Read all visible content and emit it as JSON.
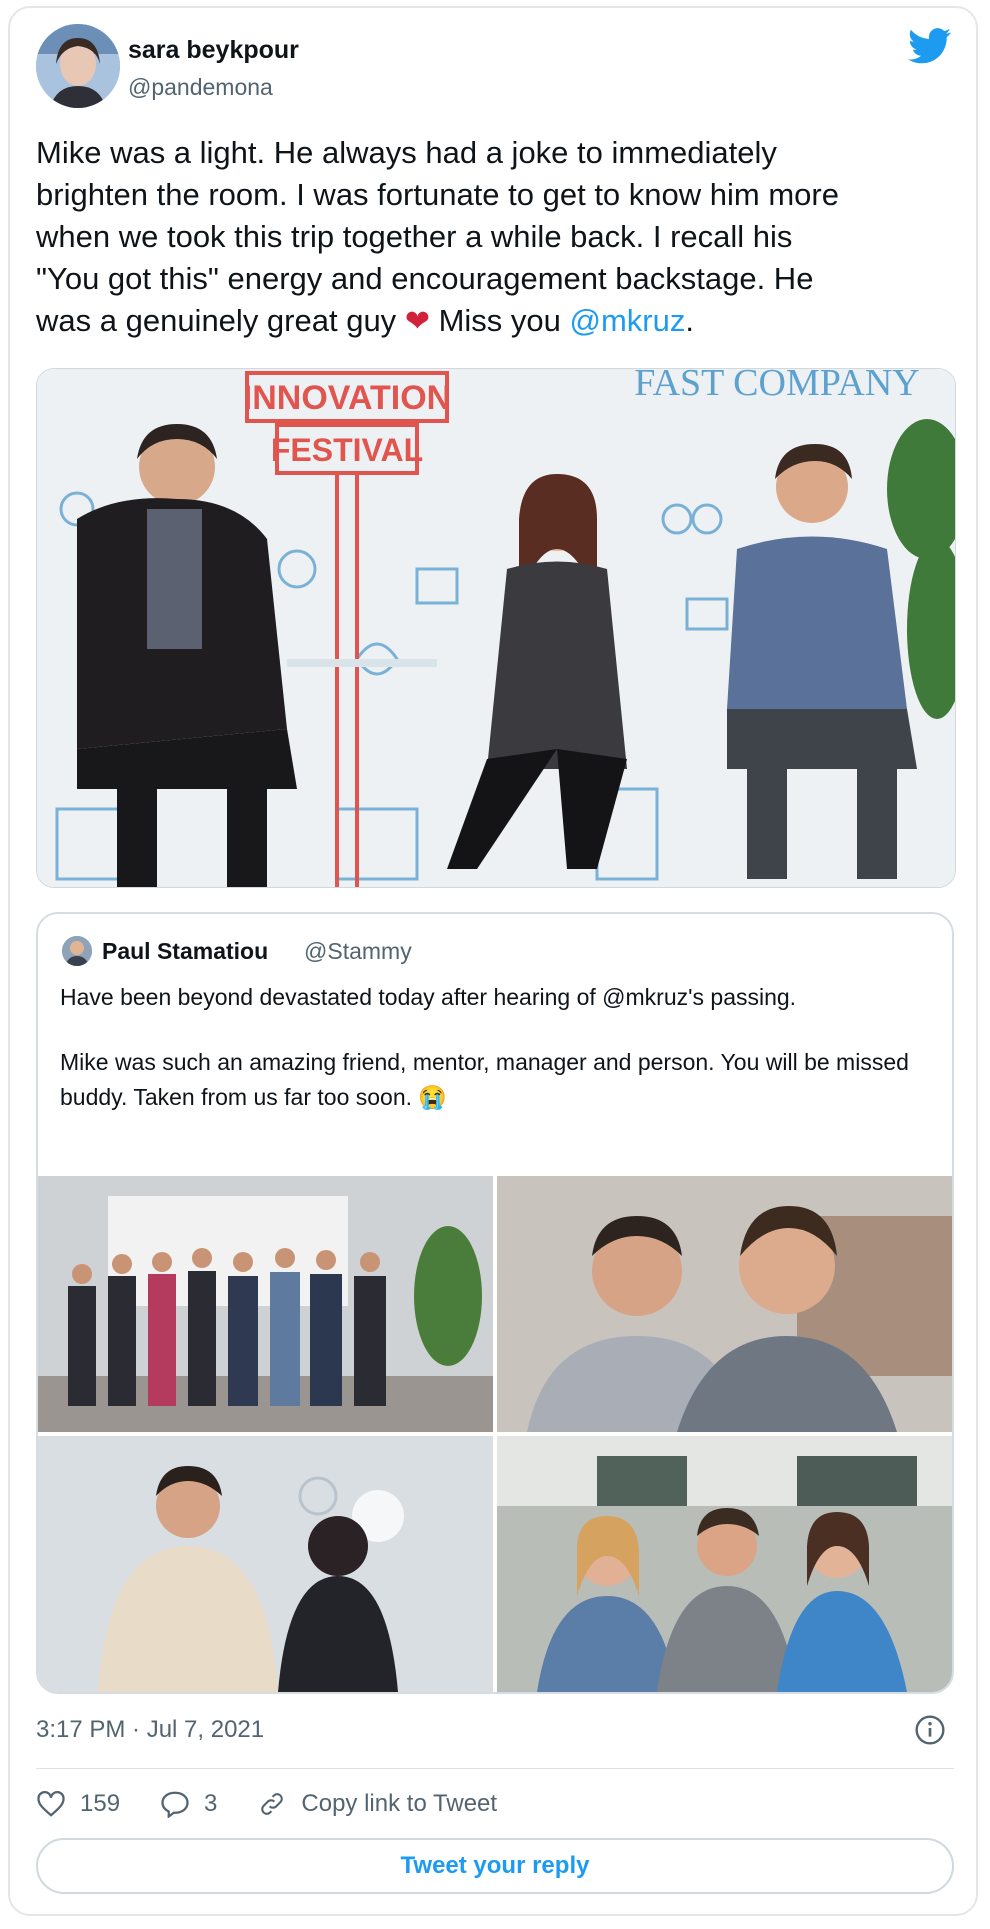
{
  "author": {
    "name": "sara beykpour",
    "handle": "@pandemona"
  },
  "tweet": {
    "line1": "Mike was a light. He always had a joke to immediately",
    "line2": "brighten the room. I was fortunate to get to know him more",
    "line3": "when we took this trip together a while back. I recall his",
    "line4": "\"You got this\" energy and encouragement backstage. He",
    "line5_pre": "was a genuinely great guy",
    "heart": "❤",
    "line5_mid": "Miss you",
    "mention": "@mkruz",
    "line5_end": "."
  },
  "media": {
    "banner_left": "INNOVATION",
    "banner_sub": "FESTIVAL",
    "banner_right": "FAST COMPANY"
  },
  "quote": {
    "name": "Paul Stamatiou",
    "handle": "@Stammy",
    "p1": "Have been beyond devastated today after hearing of @mkruz's passing.",
    "p2": "Mike was such an amazing friend, mentor, manager and person. You will be missed buddy. Taken from us far too soon. 😭"
  },
  "timestamp": "3:17 PM · Jul 7, 2021",
  "actions": {
    "likes": "159",
    "replies": "3",
    "copy_link": "Copy link to Tweet"
  },
  "reply_label": "Tweet your reply",
  "colors": {
    "accent": "#1d9bf0",
    "text": "#0f1419",
    "muted": "#536471",
    "heart": "#d0223a"
  },
  "icons": [
    "twitter-bird-icon",
    "info-icon",
    "heart-icon",
    "reply-icon",
    "link-icon"
  ]
}
